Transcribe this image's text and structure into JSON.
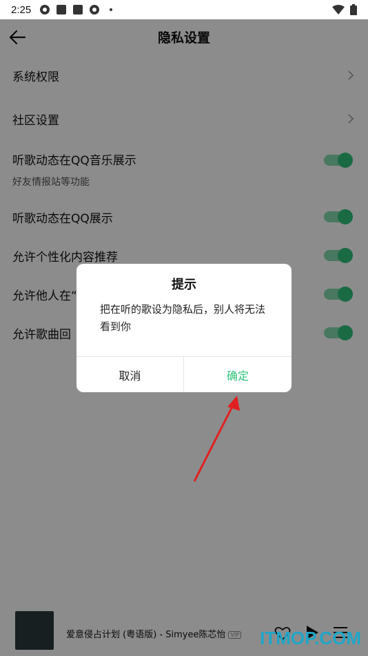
{
  "status_bar": {
    "time": "2:25"
  },
  "header": {
    "title": "隐私设置"
  },
  "settings": {
    "system_permissions": "系统权限",
    "community_settings": "社区设置",
    "listen_activity_qqmusic": "听歌动态在QQ音乐展示",
    "listen_activity_qqmusic_sub": "好友情报站等功能",
    "listen_activity_qq": "听歌动态在QQ展示",
    "personalized_recommend": "允许个性化内容推荐",
    "allow_others": "允许他人在“",
    "allow_song_reply": "允许歌曲回"
  },
  "dialog": {
    "title": "提示",
    "message": "把在听的歌设为隐私后，别人将无法看到你",
    "cancel": "取消",
    "confirm": "确定"
  },
  "player": {
    "song": "爱意侵占计划 (粤语版) - Simyee陈芯怡",
    "badge": "VIP"
  },
  "watermark": "ITMOP.COM",
  "colors": {
    "accent": "#31c27c",
    "arrow": "#e02020",
    "watermark": "#1fa6c8"
  }
}
